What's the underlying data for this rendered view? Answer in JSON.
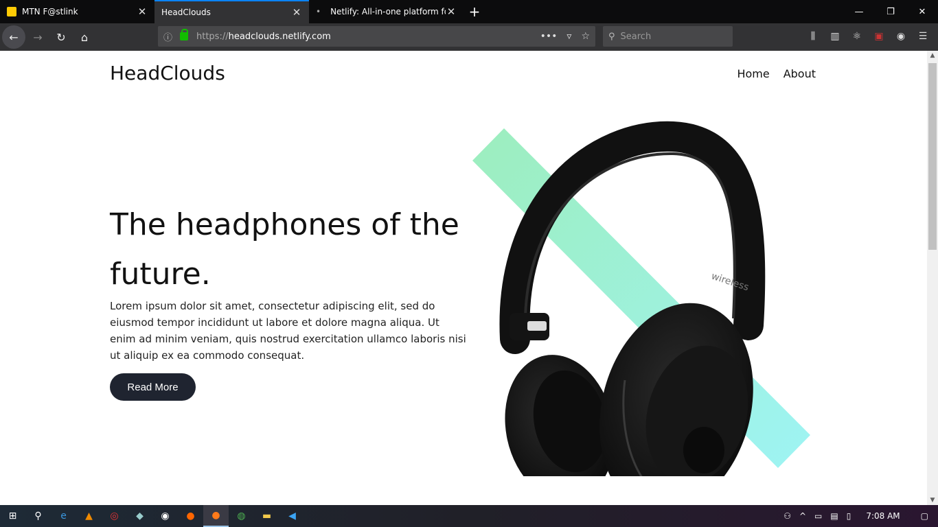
{
  "browser": {
    "tabs": [
      {
        "title": "MTN F@stlink",
        "active": false
      },
      {
        "title": "HeadClouds",
        "active": true
      },
      {
        "title": "Netlify: All-in-one platform for",
        "active": false
      }
    ],
    "url_proto": "https://",
    "url_host": "headclouds.netlify.com",
    "search_placeholder": "Search"
  },
  "site": {
    "brand": "HeadClouds",
    "nav": [
      "Home",
      "About"
    ],
    "hero_title": "The headphones of the future.",
    "hero_text": "Lorem ipsum dolor sit amet, consectetur adipiscing elit, sed do eiusmod tempor incididunt ut labore et dolore magna aliqua. Ut enim ad minim veniam, quis nostrud exercitation ullamco laboris nisi ut aliquip ex ea commodo consequat.",
    "cta_label": "Read More",
    "headphone_text": "wireless"
  },
  "taskbar": {
    "clock": "7:08 AM"
  },
  "colors": {
    "accent_gradient_start": "#7ce8a8",
    "accent_gradient_end": "#7ef0f0",
    "cta_bg": "#1f2430",
    "tab_highlight": "#0a84ff"
  }
}
